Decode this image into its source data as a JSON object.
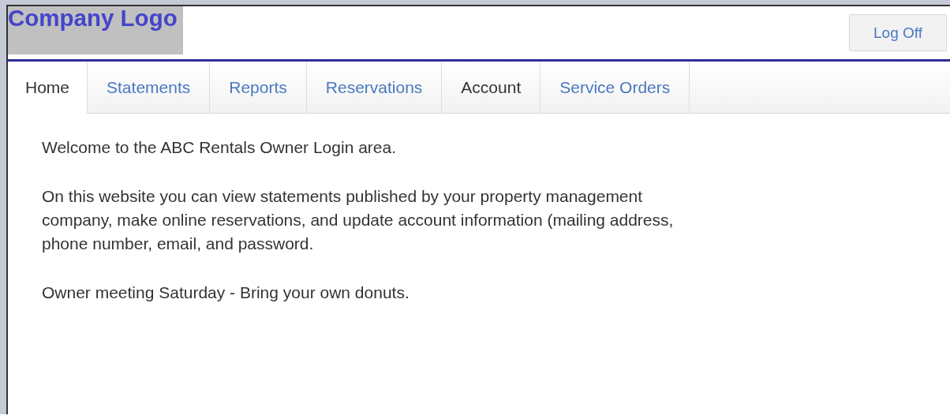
{
  "header": {
    "logo": "Company Logo",
    "log_off": "Log Off"
  },
  "tabs": [
    {
      "label": "Home",
      "selected": true,
      "disabled": false
    },
    {
      "label": "Statements",
      "selected": false,
      "disabled": false
    },
    {
      "label": "Reports",
      "selected": false,
      "disabled": false
    },
    {
      "label": "Reservations",
      "selected": false,
      "disabled": false
    },
    {
      "label": "Account",
      "selected": false,
      "disabled": true
    },
    {
      "label": "Service Orders",
      "selected": false,
      "disabled": false
    }
  ],
  "content": {
    "paragraphs": [
      "Welcome to the ABC Rentals Owner Login area.",
      "On this website you can view statements published by your property management company, make online reservations, and update account information (mailing address, phone number, email, and password.",
      "Owner meeting Saturday - Bring your own donuts."
    ]
  }
}
